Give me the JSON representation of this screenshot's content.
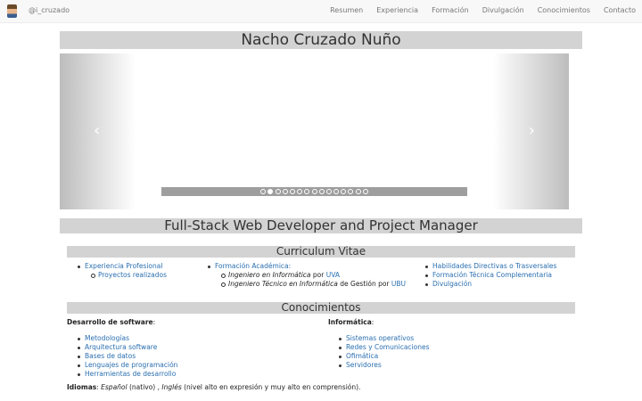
{
  "navbar": {
    "handle": "@i_cruzado",
    "items": [
      "Resumen",
      "Experiencia",
      "Formación",
      "Divulgación",
      "Conocimientos",
      "Contacto"
    ]
  },
  "heading": {
    "name": "Nacho Cruzado Nuño"
  },
  "carousel": {
    "prev_arrow": "‹",
    "next_arrow": "›",
    "slide_count": 15,
    "active_index": 1
  },
  "subtitle": "Full-Stack Web Developer and Project Manager",
  "cv": {
    "title": "Curriculum Vitae",
    "col1": {
      "item": "Experiencia Profesional",
      "sub": "Proyectos realizados"
    },
    "col2": {
      "item": "Formación Académica:",
      "deg1_title": "Ingeniero en Informática",
      "deg1_por": " por ",
      "deg1_uni": "UVA",
      "deg2_title": "Ingeniero Técnico en Informática",
      "deg2_rest": " de Gestión por ",
      "deg2_uni": "UBU"
    },
    "col3": [
      "Habilidades Directivas o Trasversales",
      "Formación Técnica Complementaria",
      "Divulgación"
    ]
  },
  "conocimientos": {
    "title": "Conocimientos",
    "dev_label": "Desarrollo de software",
    "dev_items": [
      "Metodologías",
      "Arquitectura software",
      "Bases de datos",
      "Lenguajes de programación",
      "Herramientas de desarrollo"
    ],
    "inf_label": "Informática",
    "inf_items": [
      "Sistemas operativos",
      "Redes y Comunicaciones",
      "Ofimática",
      "Servidores"
    ],
    "idiomas_label": "Idiomas",
    "idiomas_es": "Español",
    "idiomas_es_note": " (nativo) , ",
    "idiomas_en": "Inglés",
    "idiomas_en_note": " (nivel alto en expresión y muy alto en comprensión)."
  },
  "colors": {
    "link": "#2a6fb0",
    "bar": "#d3d3d3",
    "indicator": "#9e9e9e"
  }
}
